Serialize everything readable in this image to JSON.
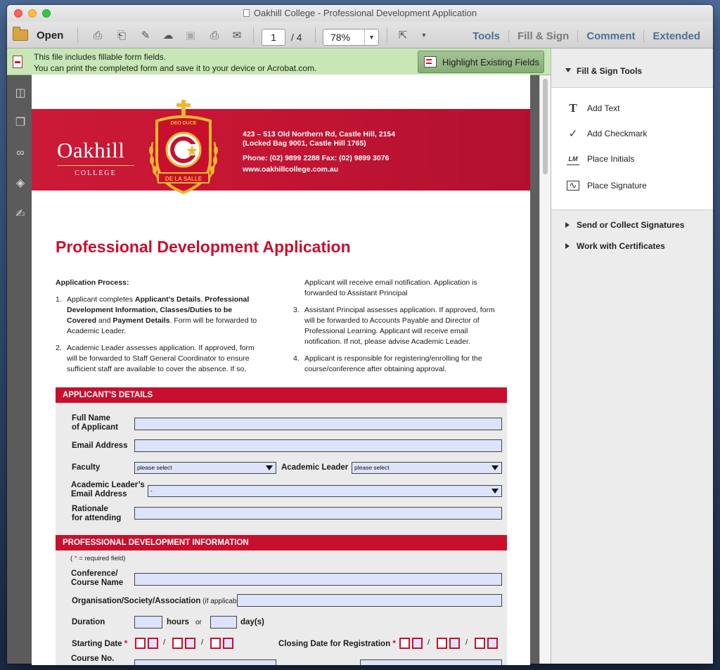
{
  "window": {
    "title": "Oakhill College - Professional Development Application"
  },
  "toolbar": {
    "open_label": "Open",
    "page_current": "1",
    "page_total": "/  4",
    "zoom": "78%",
    "links": [
      "Tools",
      "Fill & Sign",
      "Comment",
      "Extended"
    ]
  },
  "notice": {
    "line1": "This file includes fillable form fields.",
    "line2": "You can print the completed form and save it to your device or Acrobat.com.",
    "highlight_button": "Highlight Existing Fields"
  },
  "doc": {
    "logo_word": "Oakhill",
    "logo_college": "COLLEGE",
    "crest_top": "DEO DUCE",
    "crest_bottom": "DE LA SALLE",
    "address": {
      "line1": "423 – 513 Old Northern Rd, Castle Hill, 2154",
      "line2": "(Locked Bag 9001, Castle Hill 1765)",
      "phone_fax": "Phone: (02) 9899 2288   Fax: (02) 9899 3076",
      "web": "www.oakhillcollege.com.au"
    },
    "title": "Professional Development Application",
    "process": {
      "heading": "Application Process:",
      "item1_num": "1.",
      "item1_a": "Applicant completes ",
      "item1_b": "Applicant’s Details",
      "item1_c": ", ",
      "item1_d": "Professional Development Information, Classes/Duties to be Covered",
      "item1_e": " and ",
      "item1_f": "Payment Details",
      "item1_g": ". Form will be forwarded to Academic Leader.",
      "item2_num": "2.",
      "item2": "Academic Leader assesses application. If approved, form will be forwarded to Staff General Coordinator to ensure sufficient staff are available to cover the absence. If so,",
      "item2_cont": "Applicant will receive email notification. Application is forwarded to Assistant Principal",
      "item3_num": "3.",
      "item3": "Assistant Principal assesses application. If approved, form will be forwarded to Accounts Payable and Director of Professional Learning. Applicant will receive email notification. If not, please advise Academic Leader.",
      "item4_num": "4.",
      "item4": "Applicant is responsible for registering/enrolling for the course/conference after obtaining approval."
    },
    "applicant_section": {
      "title": "APPLICANT’S DETAILS",
      "full_name_label_1": "Full Name",
      "full_name_label_2": "of Applicant",
      "email_label": "Email Address",
      "faculty_label": "Faculty",
      "faculty_value": "please select",
      "academic_leader_label": "Academic Leader",
      "academic_leader_value": "please select",
      "al_email_label_1": "Academic Leader’s",
      "al_email_label_2": "Email Address",
      "al_email_value": "-",
      "rationale_label_1": "Rationale",
      "rationale_label_2": "for attending"
    },
    "pd_section": {
      "title": "PROFESSIONAL DEVELOPMENT INFORMATION",
      "required_note_a": "( ",
      "required_note_star": "*",
      "required_note_b": " = required field)",
      "conference_label_1": "Conference/",
      "conference_label_2": "Course Name",
      "org_label": "Organisation/Society/Association",
      "org_label_small": " (if applicable)",
      "duration_label": "Duration",
      "hours_label": "hours",
      "or_label": "or",
      "days_label": "day(s)",
      "starting_label": "Starting Date",
      "star": "*",
      "closing_label": "Closing Date for Registration",
      "slash": "/",
      "course_no_label": "Course No."
    }
  },
  "right_panel": {
    "header": "Fill & Sign Tools",
    "tools": [
      "Add Text",
      "Add Checkmark",
      "Place Initials",
      "Place Signature"
    ],
    "collapsed": [
      "Send or Collect Signatures",
      "Work with Certificates"
    ]
  }
}
